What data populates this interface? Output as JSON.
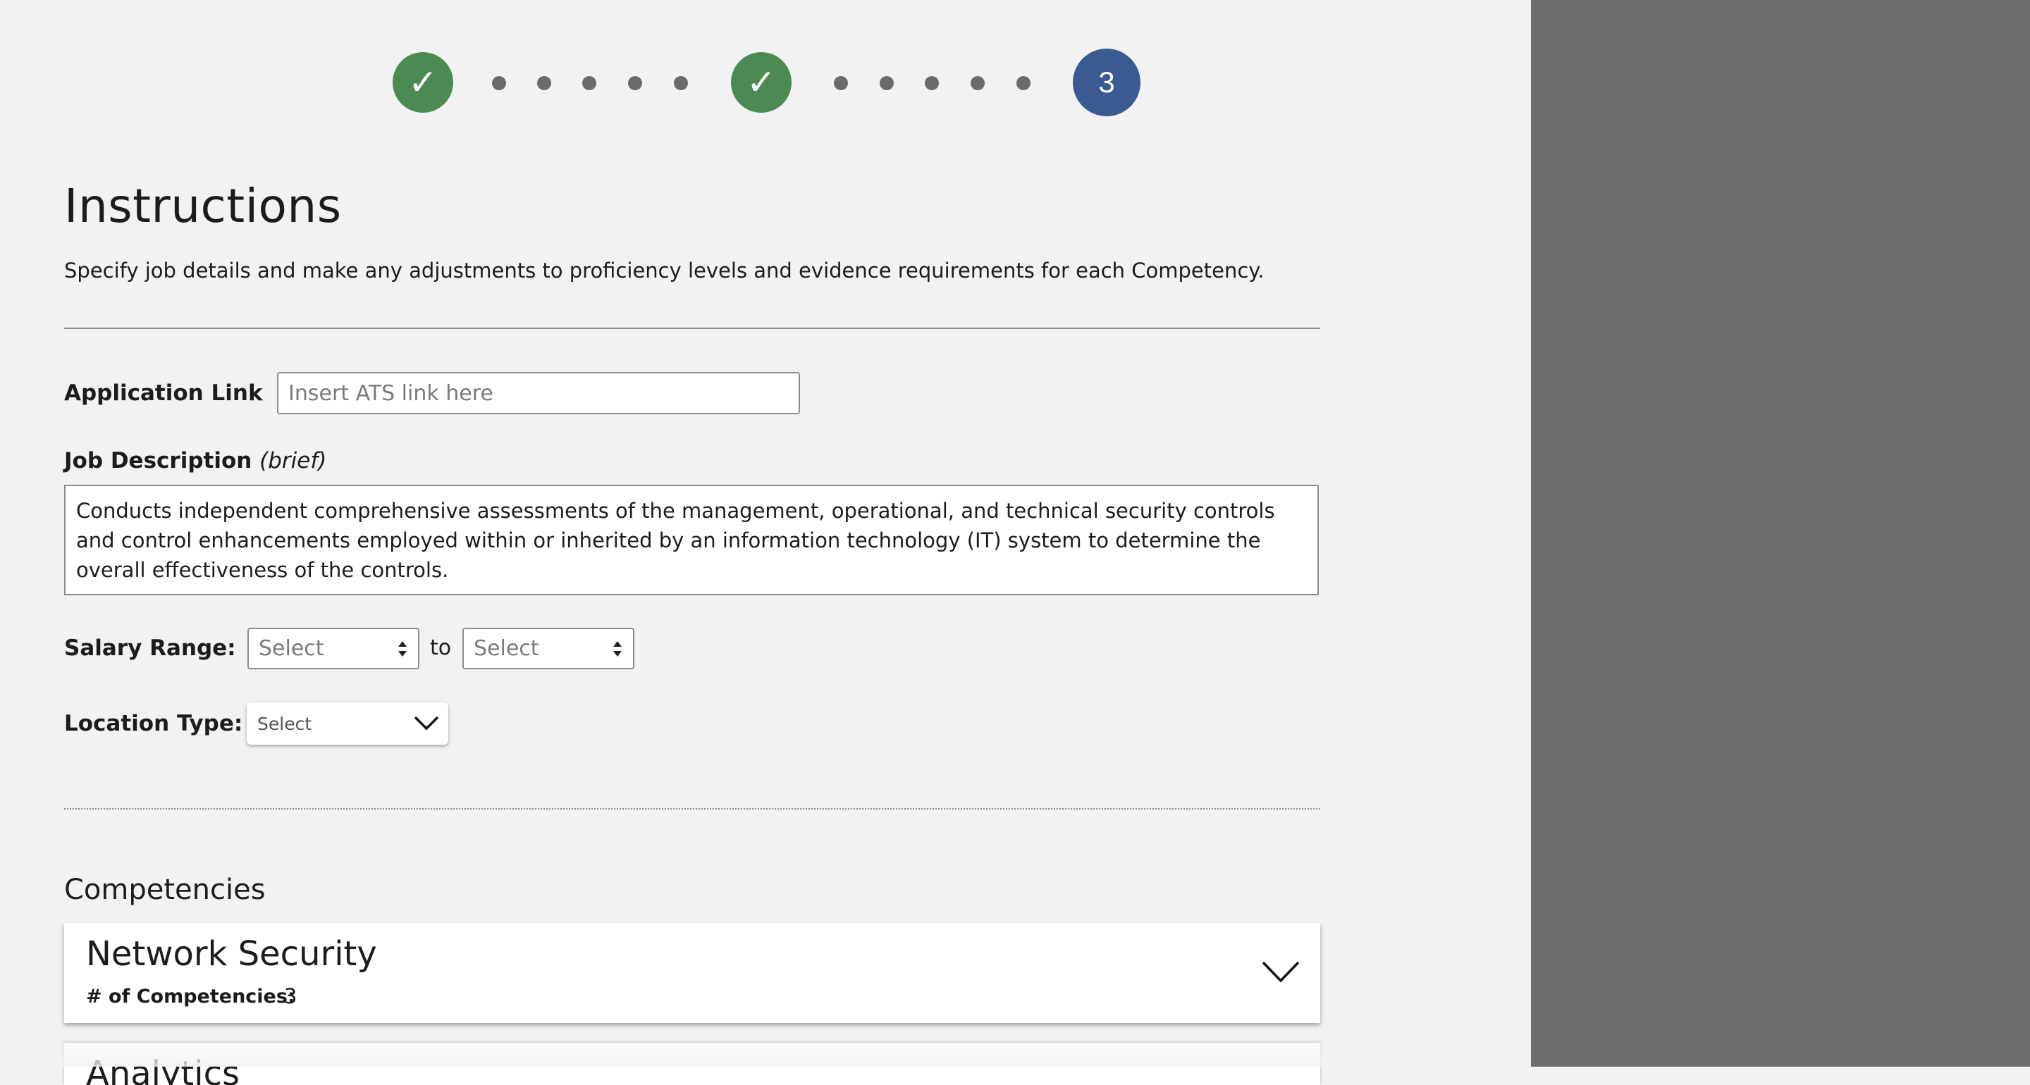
{
  "stepper": {
    "done_glyph": "✓",
    "current_label": "3",
    "colors": {
      "done": "#4b8a52",
      "current": "#3b5a92",
      "dot": "#6b6b6b"
    }
  },
  "instructions": {
    "title": "Instructions",
    "subtitle": "Specify job details and make any adjustments to proficiency levels and evidence requirements for each Competency."
  },
  "form": {
    "application_link": {
      "label": "Application Link",
      "placeholder": "Insert ATS link here",
      "value": ""
    },
    "job_description": {
      "label": "Job Description",
      "label_suffix": "(brief)",
      "value": "Conducts independent comprehensive assessments of the management, operational, and technical security controls and control enhancements employed within or inherited by an information technology (IT) system to determine the overall effectiveness of the controls."
    },
    "salary_range": {
      "label": "Salary Range:",
      "from": "Select",
      "separator": "to",
      "to": "Select"
    },
    "location_type": {
      "label": "Location Type:",
      "value": "Select"
    }
  },
  "competencies": {
    "title": "Competencies",
    "cards": [
      {
        "title": "Network Security",
        "count_label": "# of Competencies:",
        "count": "3"
      },
      {
        "title": "Analytics"
      }
    ]
  },
  "side_panel": {
    "color": "#6e6e6e"
  }
}
